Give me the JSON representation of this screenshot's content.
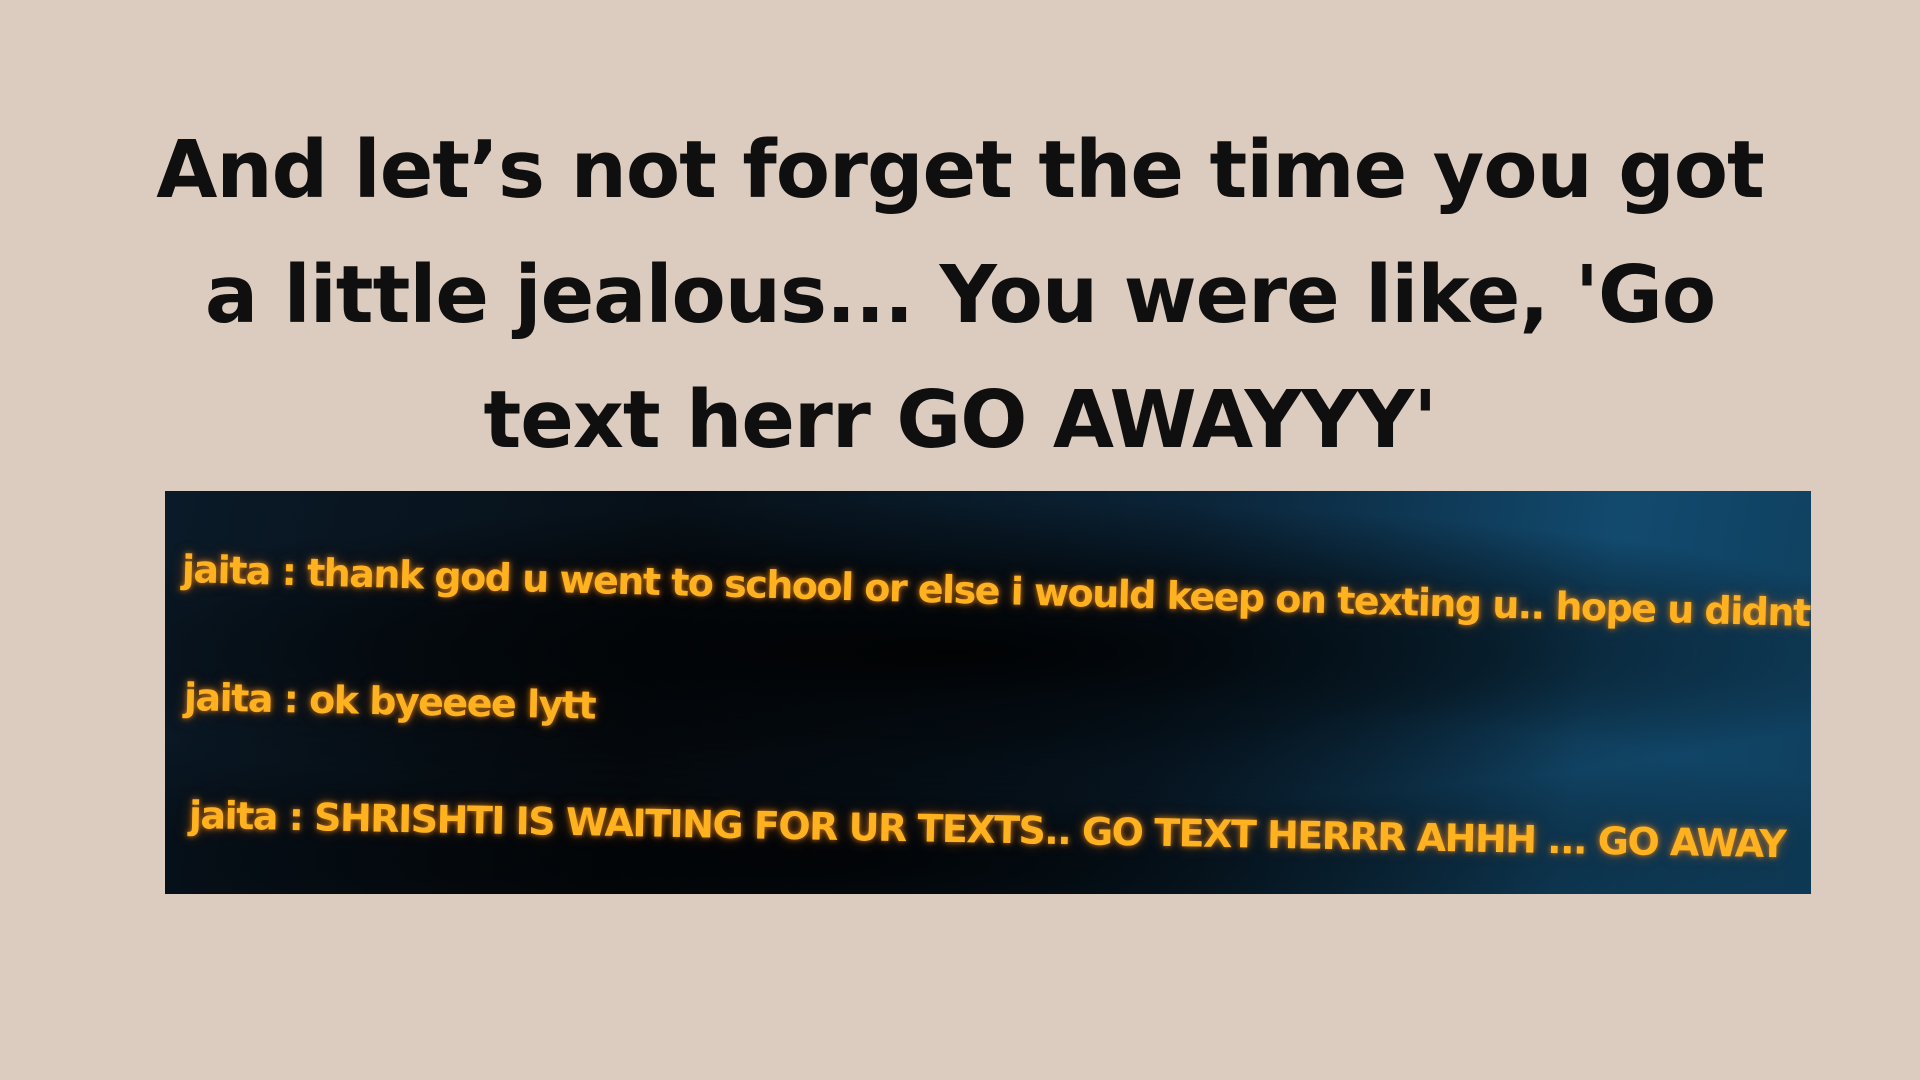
{
  "caption": {
    "line1": "And let’s not forget the time you got",
    "line2": "a little jealous... You were like, 'Go",
    "line3": "text herr GO AWAYYY'"
  },
  "chat_screenshot": {
    "messages": [
      {
        "text": "jaita : thank god u went to school or else i would keep on texting u.. hope u didnt ta"
      },
      {
        "text": "jaita : ok byeeee lytt"
      },
      {
        "text": "jaita : SHRISHTI IS WAITING FOR UR TEXTS.. GO TEXT HERRR AHHH ... GO AWAY"
      }
    ]
  },
  "colors": {
    "background": "#dccbbf",
    "caption_text": "#0f0f0f",
    "chat_text": "#ffb21f",
    "chat_background": "#0b2438"
  }
}
